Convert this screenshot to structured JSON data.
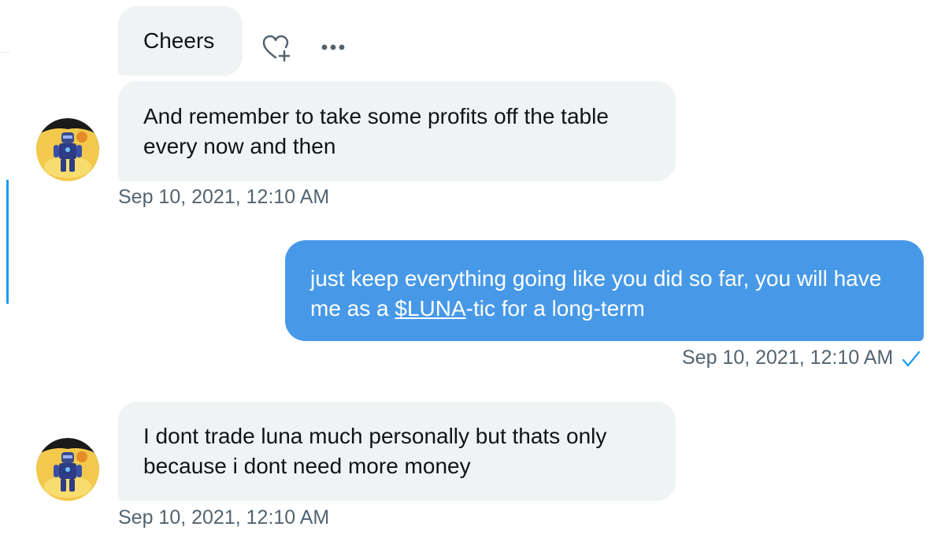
{
  "messages": [
    {
      "text": "Cheers",
      "direction": "received"
    },
    {
      "text": "And remember to take some profits off the table every now and then",
      "direction": "received",
      "timestamp": "Sep 10, 2021, 12:10 AM"
    },
    {
      "text_before_link": "just keep everything going like you did so far, you will have me as a ",
      "link_text": "$LUNA",
      "text_after_link": "-tic for a long-term",
      "direction": "sent",
      "timestamp": "Sep 10, 2021, 12:10 AM",
      "status": "read"
    },
    {
      "text": "I dont trade luna much personally but thats only because i dont need more money",
      "direction": "received",
      "timestamp": "Sep 10, 2021, 12:10 AM"
    }
  ],
  "icons": {
    "react": "heart-plus-icon",
    "more": "more-horizontal-icon",
    "read_receipt": "checkmark-icon"
  },
  "colors": {
    "received_bubble": "#eff3f4",
    "sent_bubble": "#4799e8",
    "timestamp_text": "#536471",
    "accent": "#1d9bf0"
  }
}
